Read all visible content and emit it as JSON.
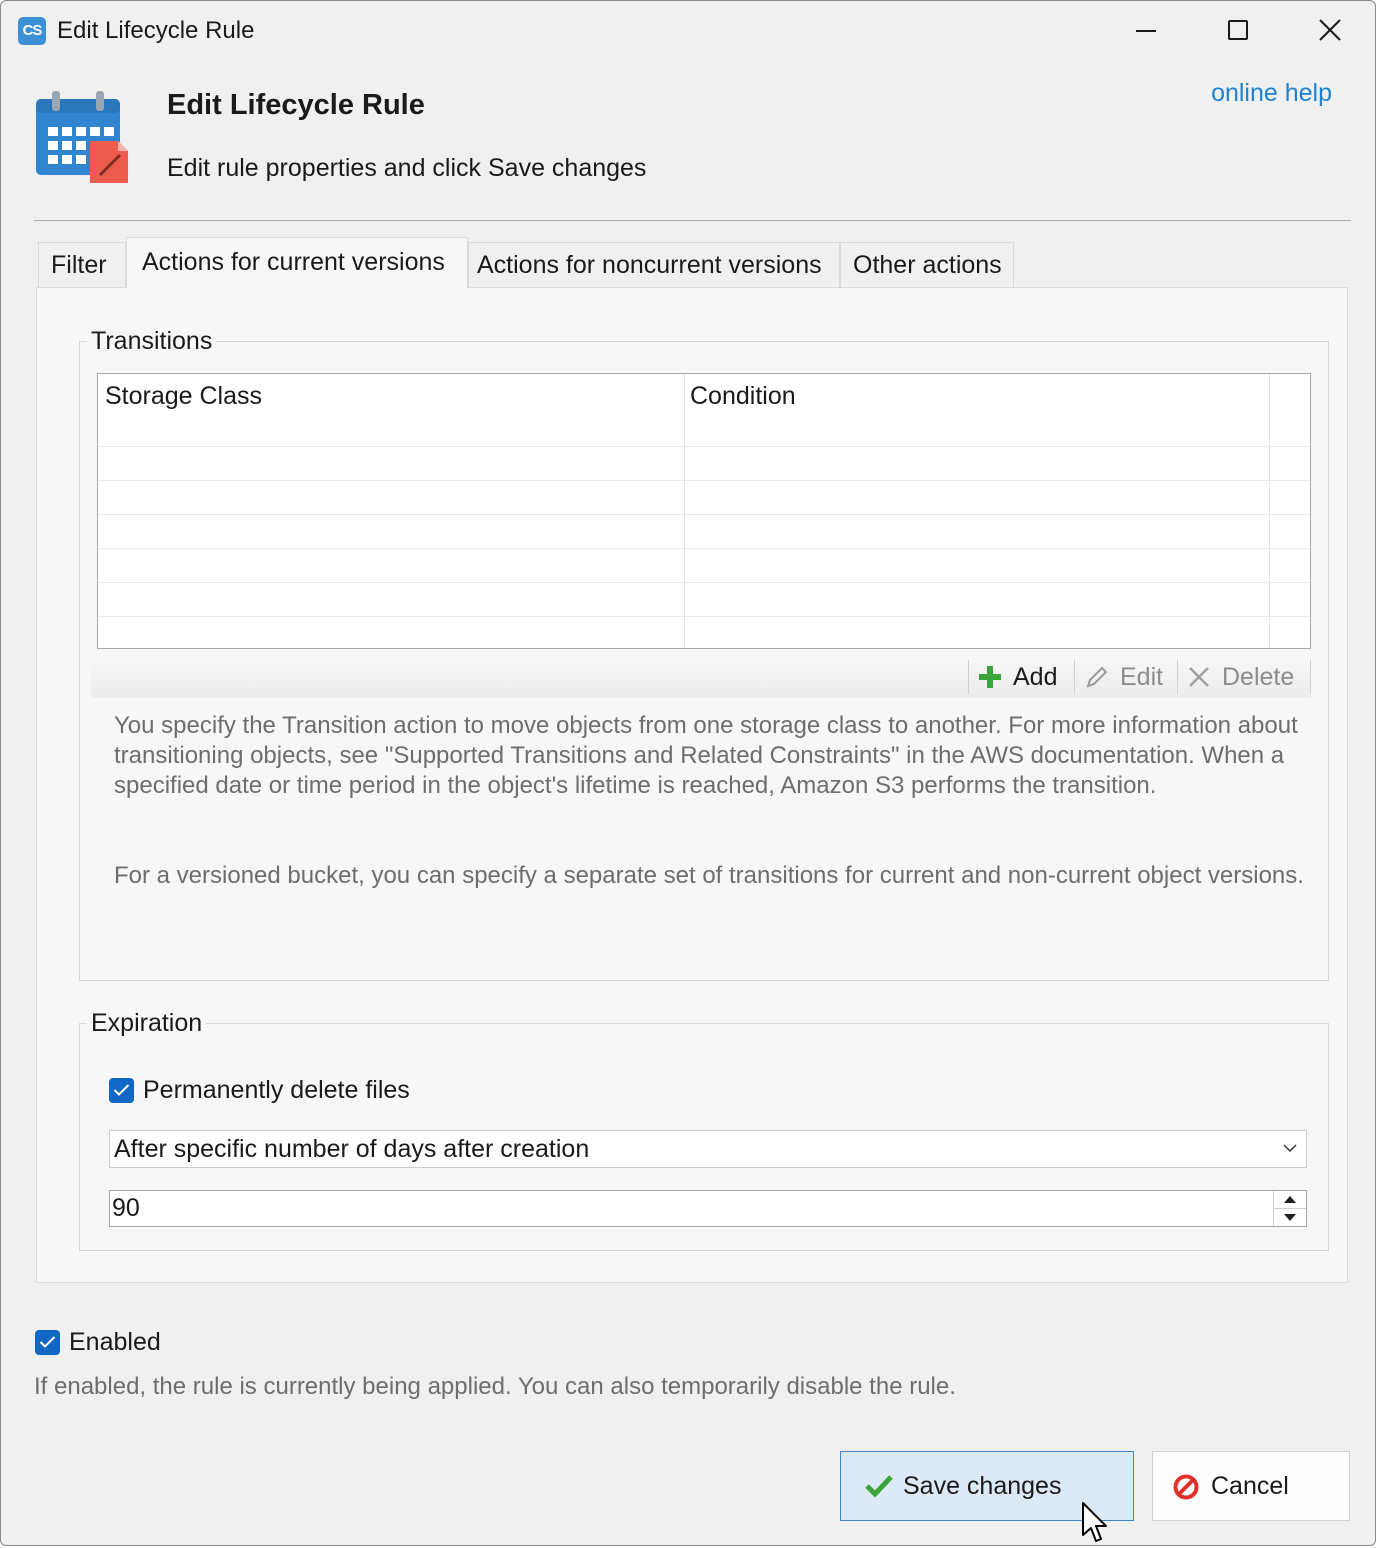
{
  "window": {
    "title": "Edit Lifecycle Rule",
    "app_icon_text": "CS"
  },
  "header": {
    "title": "Edit Lifecycle Rule",
    "subtitle": "Edit rule properties and click Save changes",
    "help_link": "online help"
  },
  "tabs": [
    {
      "label": "Filter",
      "active": false
    },
    {
      "label": "Actions for current versions",
      "active": true
    },
    {
      "label": "Actions for noncurrent versions",
      "active": false
    },
    {
      "label": "Other actions",
      "active": false
    }
  ],
  "transitions": {
    "group_label": "Transitions",
    "columns": [
      "Storage Class",
      "Condition"
    ],
    "rows": [],
    "toolbar": {
      "add_label": "Add",
      "edit_label": "Edit",
      "delete_label": "Delete"
    },
    "description_1": "You specify the Transition action to move objects from one storage class to another. For more information about transitioning objects, see \"Supported Transitions and Related Constraints\" in the AWS documentation. When a specified date or time period in the object's lifetime is reached, Amazon S3 performs the transition.",
    "description_2": "For a versioned bucket, you can specify a separate set of transitions for current and non-current object versions."
  },
  "expiration": {
    "group_label": "Expiration",
    "permanently_delete_label": "Permanently delete files",
    "permanently_delete_checked": true,
    "mode_selected": "After specific number of days after creation",
    "days_value": "90"
  },
  "enabled": {
    "label": "Enabled",
    "checked": true,
    "description": "If enabled, the rule is currently being applied. You can also temporarily disable the rule."
  },
  "buttons": {
    "save_label": "Save changes",
    "cancel_label": "Cancel"
  },
  "colors": {
    "accent": "#1068c4",
    "link": "#1e82d2",
    "add_icon": "#3aa53a",
    "cancel_icon": "#e0312b"
  }
}
